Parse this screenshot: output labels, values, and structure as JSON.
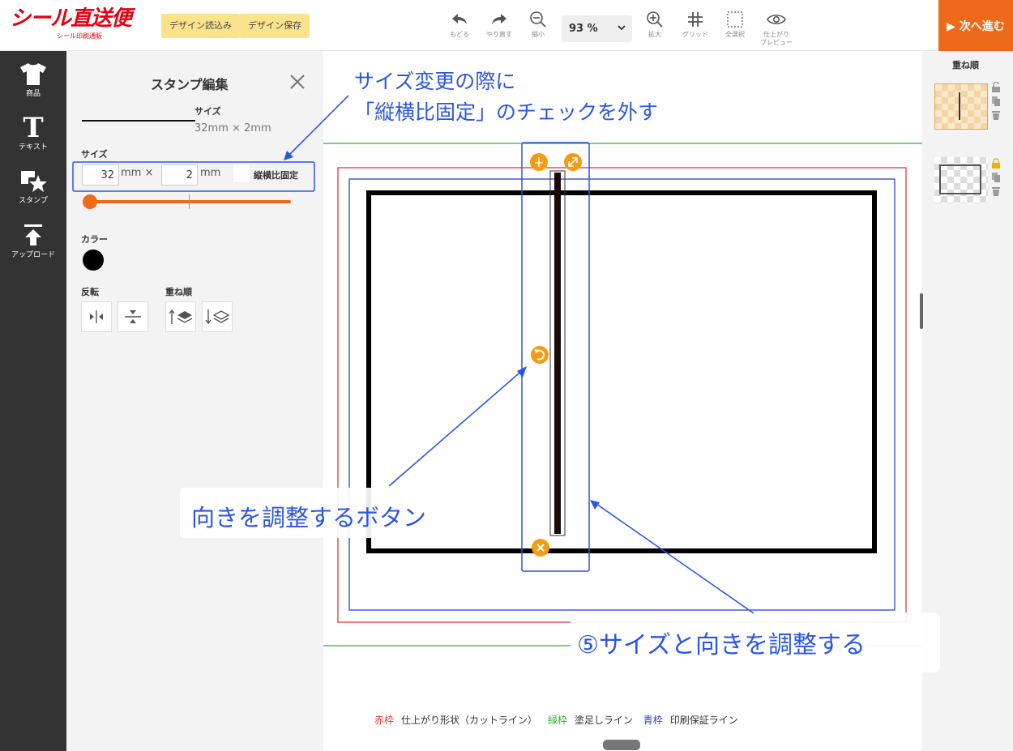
{
  "header": {
    "logo": "シール直送便",
    "logo_sub": "シール印刷通販",
    "load_design": "デザイン読込み",
    "save_design": "デザイン保存",
    "tools": {
      "undo": "もどる",
      "redo": "やり直す",
      "zoom_out": "縮小",
      "zoom_in": "拡大",
      "grid": "グリッド",
      "select_all": "全選択",
      "preview_line1": "仕上がり",
      "preview_line2": "プレビュー"
    },
    "zoom_value": "93 %",
    "next": "▶ 次へ進む"
  },
  "leftnav": {
    "items": [
      {
        "label": "商品",
        "icon": "tshirt-icon"
      },
      {
        "label": "テキスト",
        "icon": "text-t-icon"
      },
      {
        "label": "スタンプ",
        "icon": "stamp-star-icon"
      },
      {
        "label": "アップロード",
        "icon": "upload-icon"
      }
    ]
  },
  "panel": {
    "title": "スタンプ編集",
    "preview_size_label": "サイズ",
    "preview_size_value": "32mm × 2mm",
    "size_label": "サイズ",
    "width_value": "32",
    "height_value": "2",
    "unit_x": "mm ×",
    "unit": "mm",
    "aspect_lock": "縦横比固定",
    "color_label": "カラー",
    "color_value": "#000000",
    "flip_label": "反転",
    "order_label": "重ね順"
  },
  "canvas": {
    "legend": {
      "red": "赤枠",
      "red_desc": "仕上がり形状（カットライン）",
      "green": "緑枠",
      "green_desc": "塗足しライン",
      "blue": "青枠",
      "blue_desc": "印刷保証ライン"
    },
    "colors": {
      "red": "#e53935",
      "green": "#2bb52b",
      "blue": "#2a3fe0",
      "handle": "#f39c12"
    }
  },
  "rpanel": {
    "title": "重ね順"
  },
  "annotations": {
    "top_line1": "サイズ変更の際に",
    "top_line2": "「縦横比固定」のチェックを外す",
    "rotate": "向きを調整するボタン",
    "step5": "⑤サイズと向きを調整する"
  }
}
